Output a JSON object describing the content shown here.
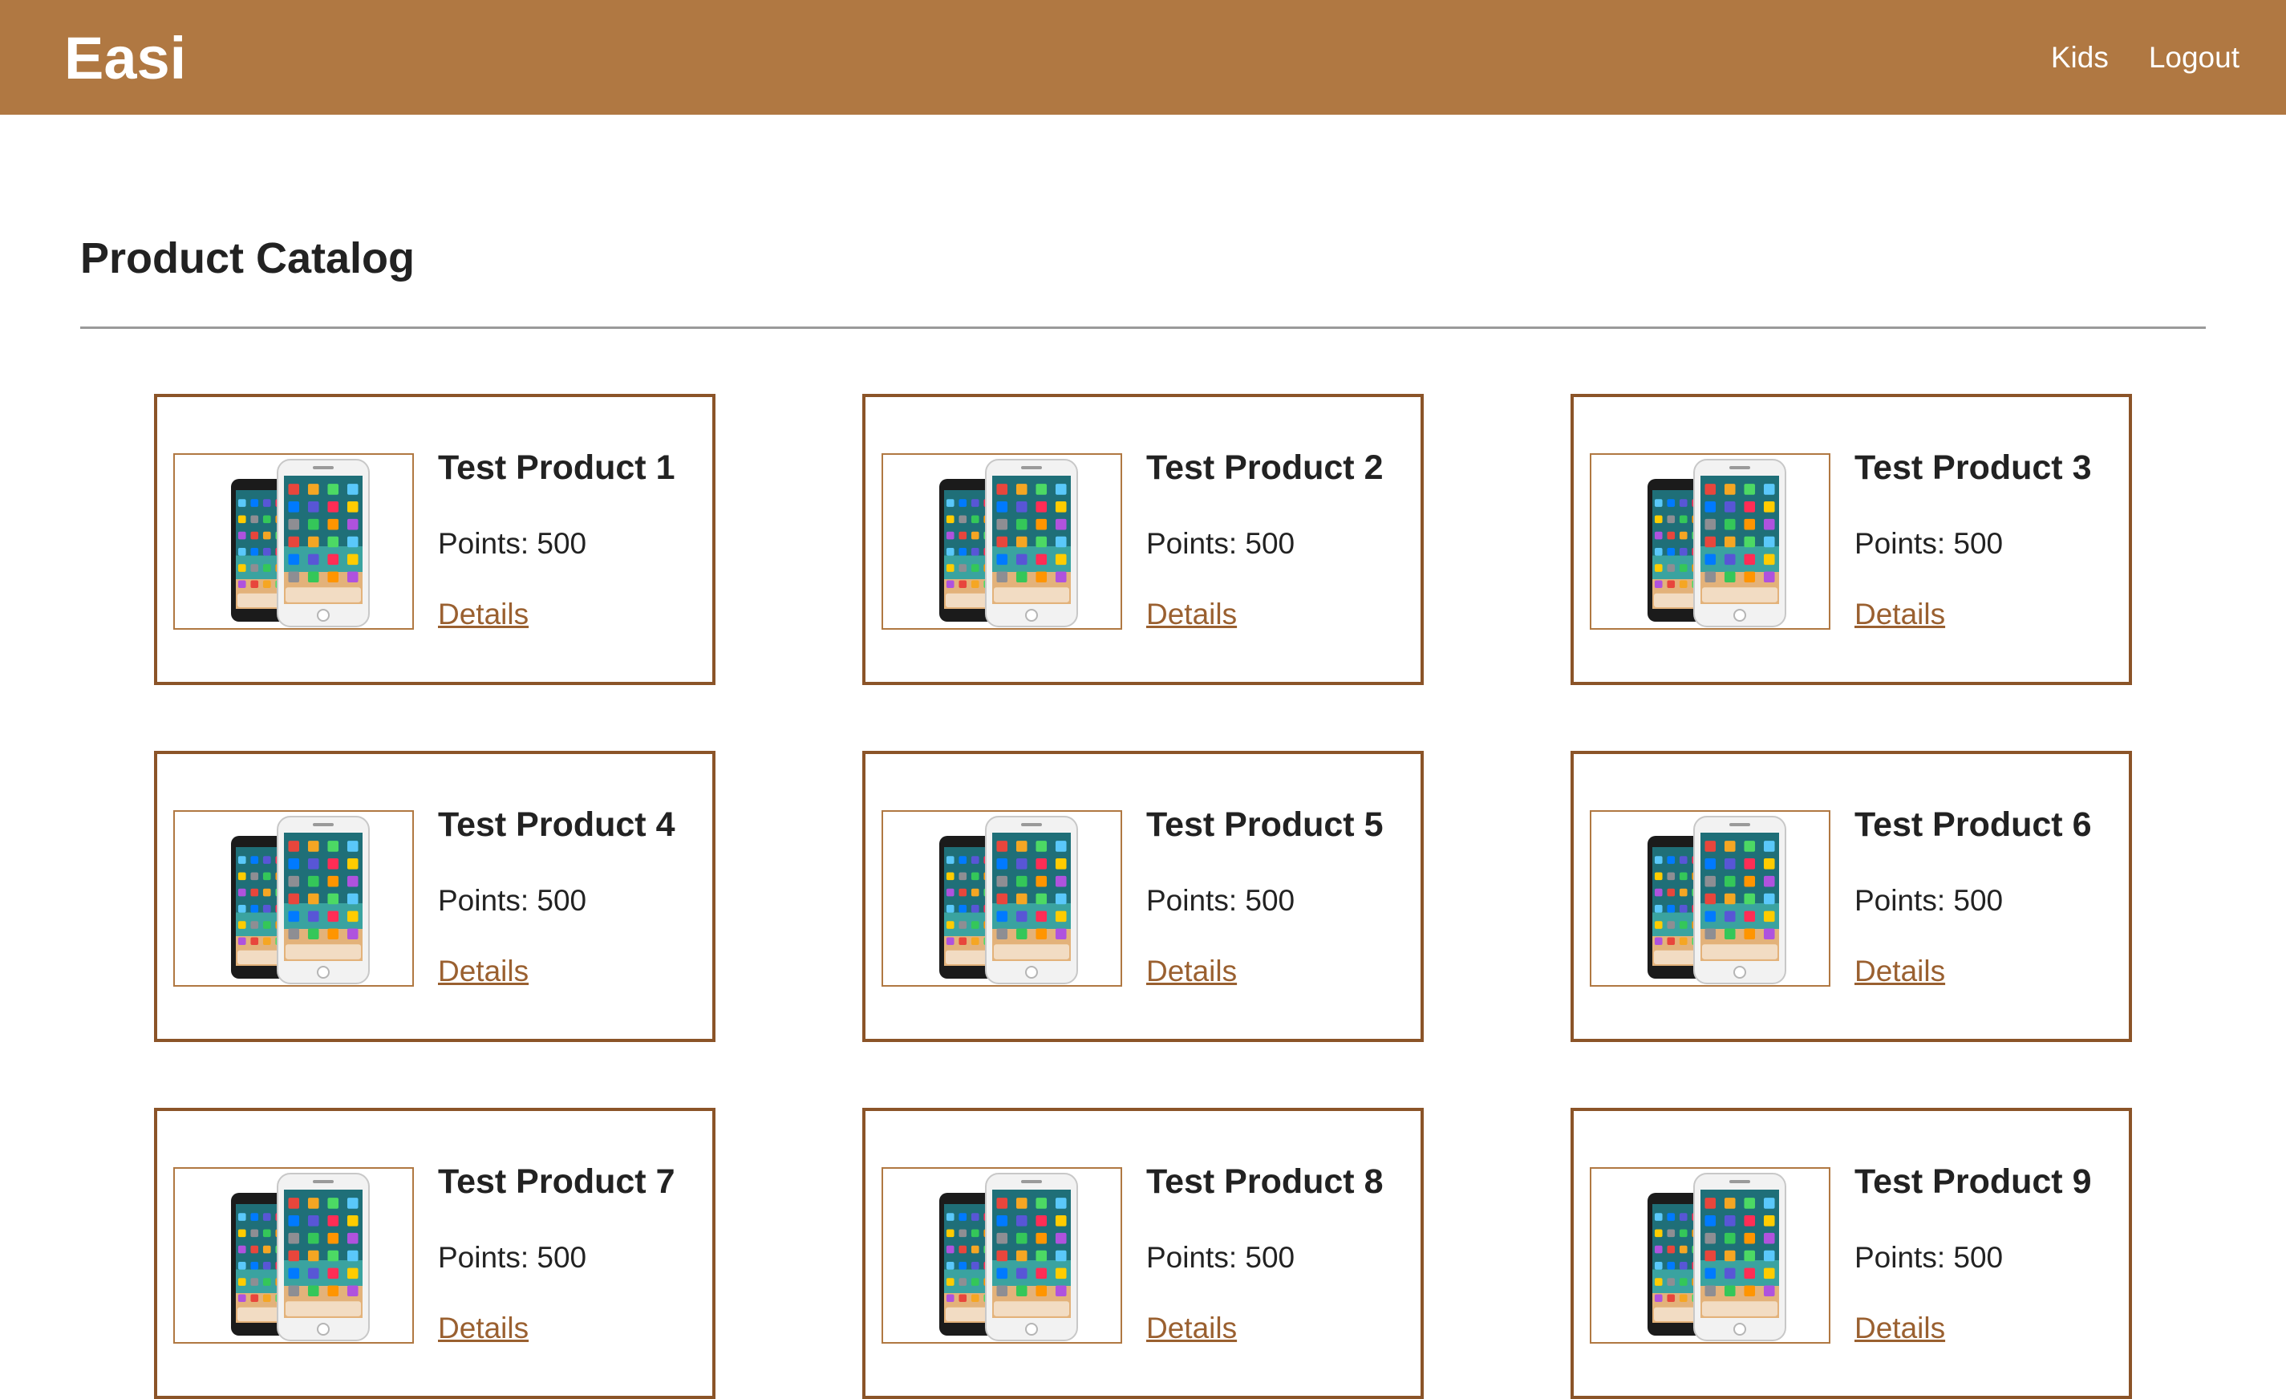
{
  "brand": "Easi",
  "nav": {
    "kids": "Kids",
    "logout": "Logout"
  },
  "page_title": "Product Catalog",
  "products": [
    {
      "title": "Test Product 1",
      "points": "Points: 500",
      "link": "Details"
    },
    {
      "title": "Test Product 2",
      "points": "Points: 500",
      "link": "Details"
    },
    {
      "title": "Test Product 3",
      "points": "Points: 500",
      "link": "Details"
    },
    {
      "title": "Test Product 4",
      "points": "Points: 500",
      "link": "Details"
    },
    {
      "title": "Test Product 5",
      "points": "Points: 500",
      "link": "Details"
    },
    {
      "title": "Test Product 6",
      "points": "Points: 500",
      "link": "Details"
    },
    {
      "title": "Test Product 7",
      "points": "Points: 500",
      "link": "Details"
    },
    {
      "title": "Test Product 8",
      "points": "Points: 500",
      "link": "Details"
    },
    {
      "title": "Test Product 9",
      "points": "Points: 500",
      "link": "Details"
    }
  ],
  "colors": {
    "navbar": "#b07842",
    "card_border": "#8b5428",
    "link": "#9a6030"
  },
  "icons": {
    "product_image": "smartphone-image"
  }
}
